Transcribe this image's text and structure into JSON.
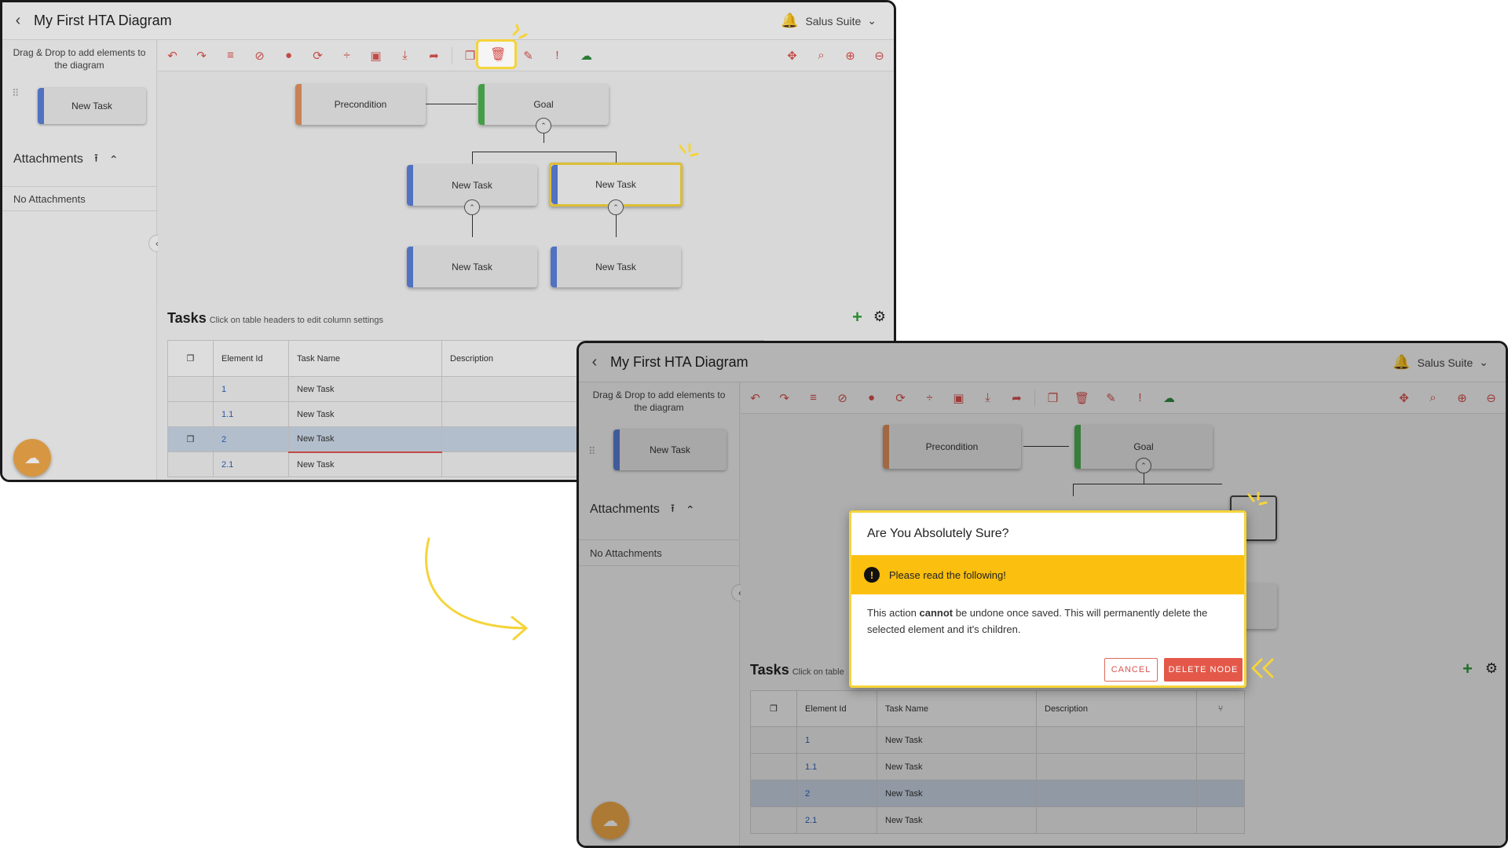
{
  "app": {
    "title": "My First HTA Diagram",
    "user_menu": "Salus Suite",
    "back_glyph": "‹",
    "bell_glyph": "🔔",
    "chevron_glyph": "⌄"
  },
  "sidebar": {
    "hint": "Drag & Drop to add elements to the diagram",
    "palette_task": "New Task",
    "attachments_label": "Attachments",
    "no_attachments": "No Attachments"
  },
  "diagram": {
    "precondition": "Precondition",
    "goal": "Goal",
    "task_1": "New Task",
    "task_2": "New Task",
    "task_1_1": "New Task",
    "task_2_1": "New Task"
  },
  "tasks_panel": {
    "title": "Tasks",
    "subtitle": "Click on table headers to edit column settings",
    "subtitle_truncated": "Click on table",
    "columns": [
      "Element Id",
      "Task Name",
      "Description"
    ],
    "rows": [
      {
        "id": "1",
        "name": "New Task"
      },
      {
        "id": "1.1",
        "name": "New Task"
      },
      {
        "id": "2",
        "name": "New Task"
      },
      {
        "id": "2.1",
        "name": "New Task"
      }
    ]
  },
  "dialog": {
    "title": "Are You Absolutely Sure?",
    "warning": "Please read the following!",
    "body_pre": "This action ",
    "body_bold": "cannot",
    "body_post": " be undone once saved. This will permanently delete the selected element and it's children.",
    "cancel": "CANCEL",
    "confirm": "DELETE NODE"
  },
  "colors": {
    "accent_yellow": "#f5d43a",
    "warning_bg": "#fbbf0f",
    "danger": "#e4584a",
    "task_bar": "#5b7fd6",
    "precondition_bar": "#e0915e",
    "goal_bar": "#4caf50",
    "add_green": "#2e9b3a"
  }
}
